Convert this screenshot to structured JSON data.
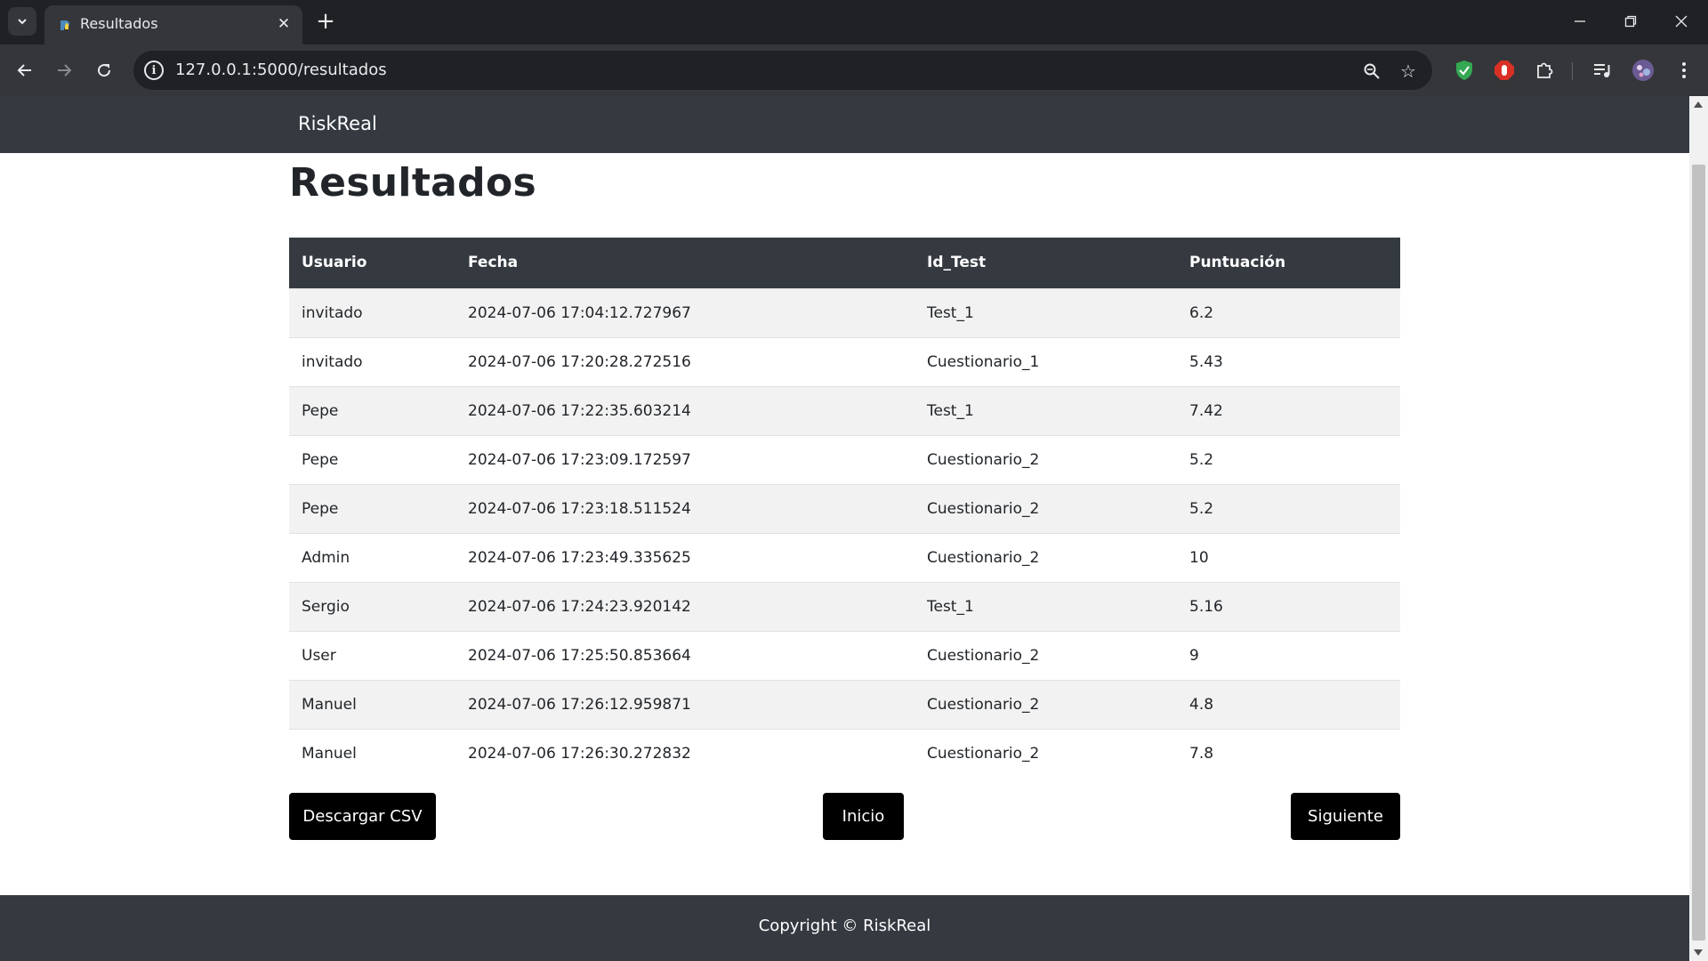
{
  "browser": {
    "tab_title": "Resultados",
    "url": "127.0.0.1:5000/resultados",
    "new_tab_symbol": "+",
    "icons": [
      "tab-search-icon",
      "favicon-icon",
      "close-icon",
      "plus-icon",
      "back-arrow-icon",
      "forward-arrow-icon",
      "reload-icon",
      "info-icon",
      "zoom-icon",
      "star-icon",
      "shield-extension-icon",
      "stop-extension-icon",
      "puzzle-icon",
      "media-control-icon",
      "avatar",
      "kebab-menu-icon",
      "minimize-icon",
      "restore-icon",
      "window-close-icon"
    ]
  },
  "navbar": {
    "brand": "RiskReal"
  },
  "page": {
    "title": "Resultados",
    "table": {
      "headers": [
        "Usuario",
        "Fecha",
        "Id_Test",
        "Puntuación"
      ],
      "rows": [
        [
          "invitado",
          "2024-07-06 17:04:12.727967",
          "Test_1",
          "6.2"
        ],
        [
          "invitado",
          "2024-07-06 17:20:28.272516",
          "Cuestionario_1",
          "5.43"
        ],
        [
          "Pepe",
          "2024-07-06 17:22:35.603214",
          "Test_1",
          "7.42"
        ],
        [
          "Pepe",
          "2024-07-06 17:23:09.172597",
          "Cuestionario_2",
          "5.2"
        ],
        [
          "Pepe",
          "2024-07-06 17:23:18.511524",
          "Cuestionario_2",
          "5.2"
        ],
        [
          "Admin",
          "2024-07-06 17:23:49.335625",
          "Cuestionario_2",
          "10"
        ],
        [
          "Sergio",
          "2024-07-06 17:24:23.920142",
          "Test_1",
          "5.16"
        ],
        [
          "User",
          "2024-07-06 17:25:50.853664",
          "Cuestionario_2",
          "9"
        ],
        [
          "Manuel",
          "2024-07-06 17:26:12.959871",
          "Cuestionario_2",
          "4.8"
        ],
        [
          "Manuel",
          "2024-07-06 17:26:30.272832",
          "Cuestionario_2",
          "7.8"
        ]
      ]
    },
    "buttons": {
      "download_csv": "Descargar CSV",
      "home": "Inicio",
      "next": "Siguiente"
    }
  },
  "footer": {
    "copyright": "Copyright © RiskReal"
  },
  "colors": {
    "navbar": "#343a40",
    "table_header": "#343a40",
    "stripe": "#f2f2f2",
    "button": "#000000",
    "chrome_dark": "#202124",
    "chrome_toolbar": "#35363a"
  }
}
